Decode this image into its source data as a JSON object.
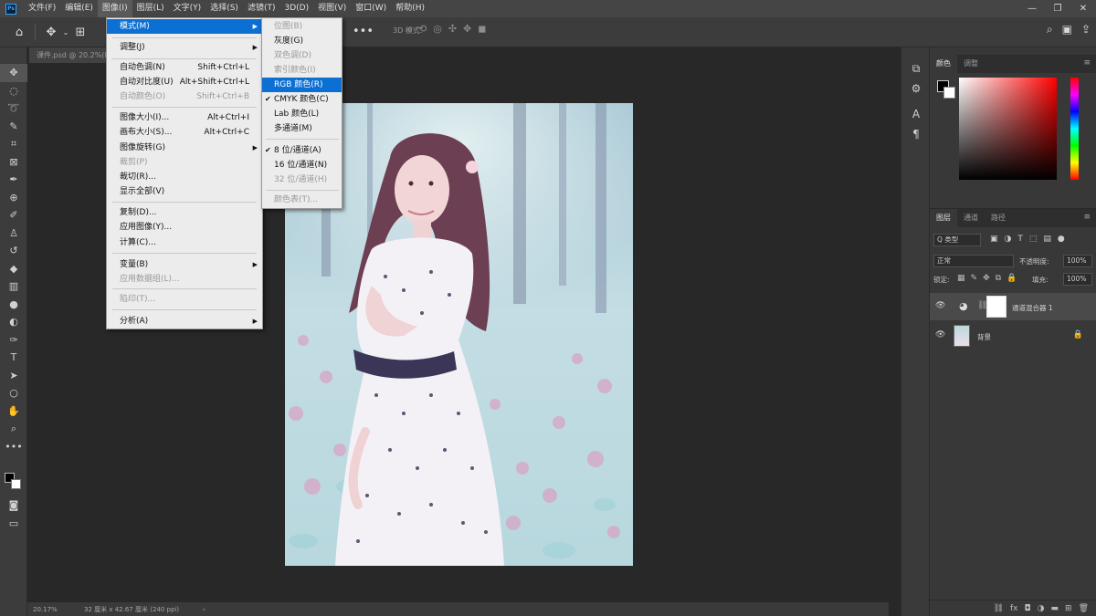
{
  "app": {
    "logo_text": "Ps"
  },
  "menubar": {
    "items": [
      "文件(F)",
      "编辑(E)",
      "图像(I)",
      "图层(L)",
      "文字(Y)",
      "选择(S)",
      "滤镜(T)",
      "3D(D)",
      "视图(V)",
      "窗口(W)",
      "帮助(H)"
    ],
    "active_index": 2
  },
  "window_controls": {
    "minimize": "—",
    "restore": "❐",
    "close": "✕"
  },
  "options_bar": {
    "three_d_mode_label": "3D 模式:"
  },
  "document": {
    "tab_title": "课件.psd @ 20.2%(RGB/8)",
    "zoom": "20.17%",
    "doc_info": "32 厘米 x 42.67 厘米 (240 ppi)",
    "status_arrow": "›"
  },
  "image_menu": {
    "items": [
      {
        "label": "模式(M)",
        "shortcut": "",
        "submenu": true,
        "disabled": false,
        "highlighted": true
      },
      {
        "label": "调整(J)",
        "shortcut": "",
        "submenu": true,
        "disabled": false
      },
      {
        "label": "自动色调(N)",
        "shortcut": "Shift+Ctrl+L",
        "disabled": false
      },
      {
        "label": "自动对比度(U)",
        "shortcut": "Alt+Shift+Ctrl+L",
        "disabled": false
      },
      {
        "label": "自动颜色(O)",
        "shortcut": "Shift+Ctrl+B",
        "disabled": true
      },
      {
        "label": "图像大小(I)...",
        "shortcut": "Alt+Ctrl+I",
        "disabled": false
      },
      {
        "label": "画布大小(S)...",
        "shortcut": "Alt+Ctrl+C",
        "disabled": false
      },
      {
        "label": "图像旋转(G)",
        "shortcut": "",
        "submenu": true,
        "disabled": false
      },
      {
        "label": "裁剪(P)",
        "shortcut": "",
        "disabled": true
      },
      {
        "label": "裁切(R)...",
        "shortcut": "",
        "disabled": false
      },
      {
        "label": "显示全部(V)",
        "shortcut": "",
        "disabled": false
      },
      {
        "label": "复制(D)...",
        "shortcut": "",
        "disabled": false
      },
      {
        "label": "应用图像(Y)...",
        "shortcut": "",
        "disabled": false
      },
      {
        "label": "计算(C)...",
        "shortcut": "",
        "disabled": false
      },
      {
        "label": "变量(B)",
        "shortcut": "",
        "submenu": true,
        "disabled": false
      },
      {
        "label": "应用数据组(L)...",
        "shortcut": "",
        "disabled": true
      },
      {
        "label": "陷印(T)...",
        "shortcut": "",
        "disabled": true
      },
      {
        "label": "分析(A)",
        "shortcut": "",
        "submenu": true,
        "disabled": false
      }
    ]
  },
  "mode_menu": {
    "items": [
      {
        "label": "位图(B)",
        "disabled": true,
        "checked": false
      },
      {
        "label": "灰度(G)",
        "disabled": false,
        "checked": false
      },
      {
        "label": "双色调(D)",
        "disabled": true,
        "checked": false
      },
      {
        "label": "索引颜色(I)",
        "disabled": true,
        "checked": false
      },
      {
        "label": "RGB 颜色(R)",
        "disabled": false,
        "checked": false,
        "highlighted": true
      },
      {
        "label": "CMYK 颜色(C)",
        "disabled": false,
        "checked": true
      },
      {
        "label": "Lab 颜色(L)",
        "disabled": false,
        "checked": false
      },
      {
        "label": "多通道(M)",
        "disabled": false,
        "checked": false
      },
      {
        "label": "8 位/通道(A)",
        "disabled": false,
        "checked": true
      },
      {
        "label": "16 位/通道(N)",
        "disabled": false,
        "checked": false
      },
      {
        "label": "32 位/通道(H)",
        "disabled": true,
        "checked": false
      },
      {
        "label": "颜色表(T)...",
        "disabled": true,
        "checked": false
      }
    ]
  },
  "color_panel": {
    "tabs": [
      "颜色",
      "调整"
    ],
    "active_tab": 0
  },
  "layers_panel": {
    "tabs": [
      "图层",
      "通道",
      "路径"
    ],
    "filter_label": "Q 类型",
    "blend_mode": "正常",
    "opacity_label": "不透明度:",
    "opacity_value": "100%",
    "lock_label": "锁定:",
    "fill_label": "填充:",
    "fill_value": "100%",
    "layers": [
      {
        "name": "通道混合器 1",
        "selected": true
      },
      {
        "name": "背景",
        "selected": false
      }
    ]
  },
  "colors": {
    "menu_highlight": "#0c6fd3",
    "app_bg": "#282828",
    "panel_bg": "#383838"
  }
}
